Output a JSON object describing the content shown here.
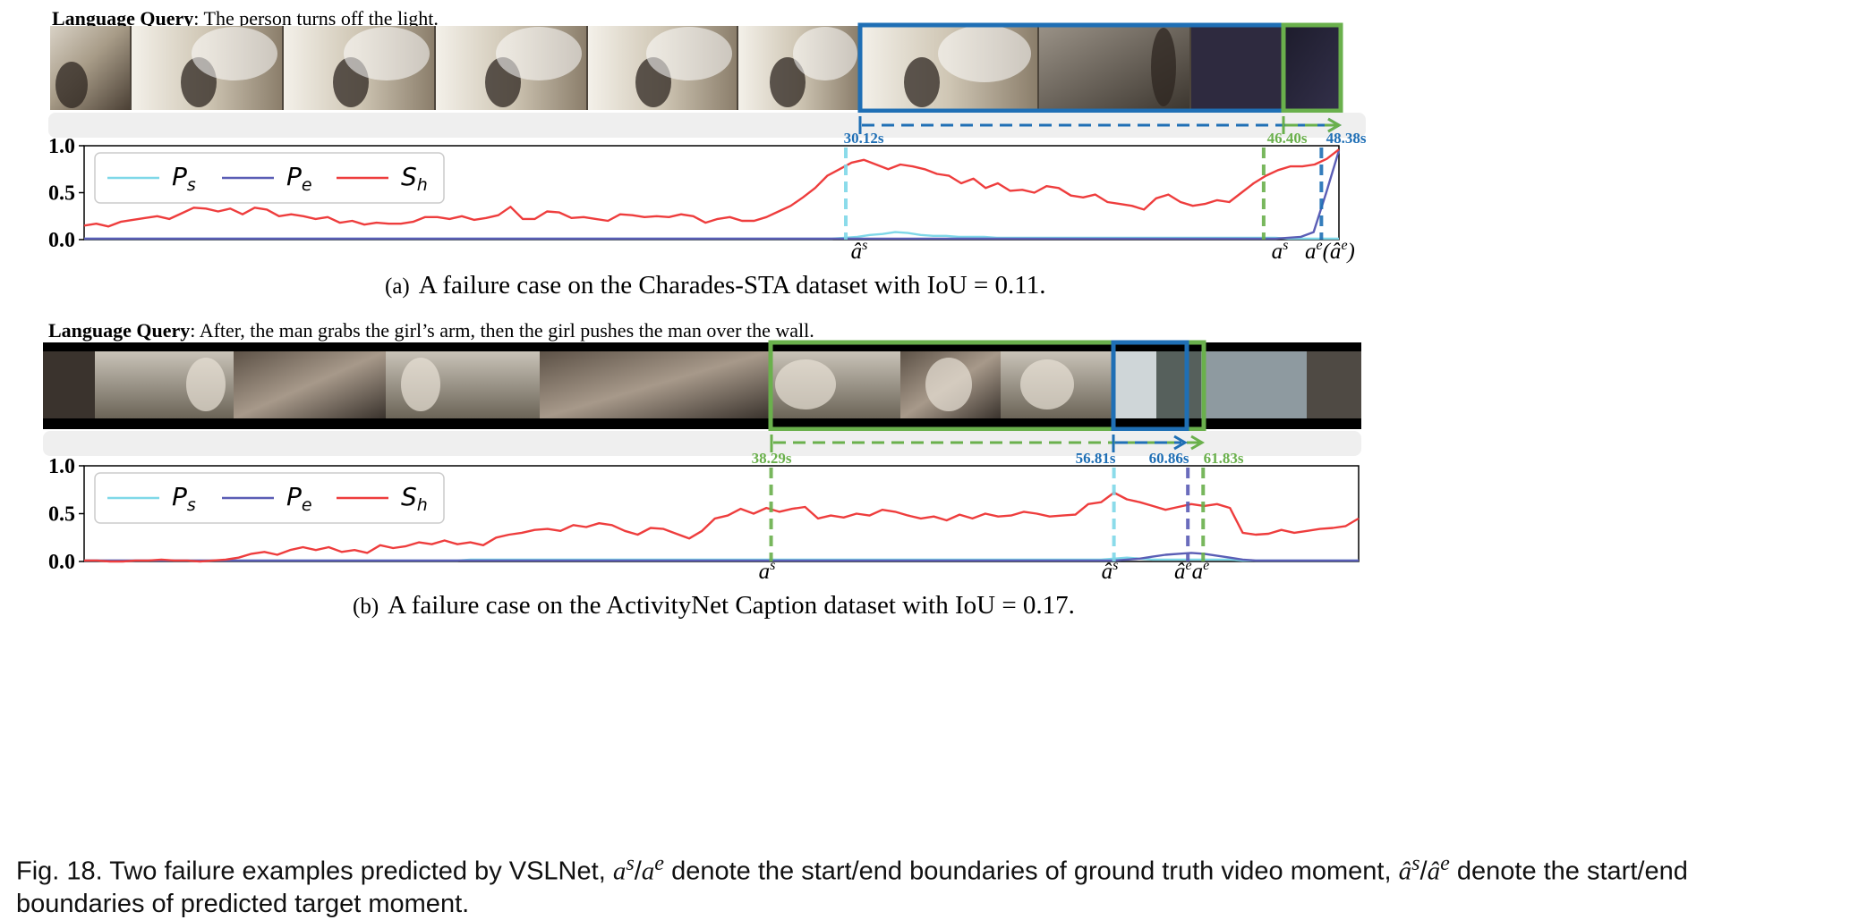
{
  "panel_a": {
    "query_label": "Language Query",
    "query_text": ": The person turns off the light.",
    "subcaption_prefix": "(a)",
    "subcaption_text": "A failure case on the Charades-STA dataset with IoU = 0.11.",
    "times": [
      "30.12s",
      "46.40s",
      "48.38s"
    ],
    "markers": [
      "â",
      "s",
      "a",
      "s",
      "a",
      "e",
      "(â",
      "e",
      ")"
    ]
  },
  "panel_b": {
    "query_label": "Language Query",
    "query_text": ": After, the man grabs the girl’s arm, then the girl pushes the man over the wall.",
    "subcaption_prefix": "(b)",
    "subcaption_text": "A failure case on the ActivityNet Caption dataset with IoU = 0.17.",
    "times": [
      "38.29s",
      "56.81s",
      "60.86s",
      "61.83s"
    ],
    "markers": [
      "a",
      "s",
      "â",
      "s",
      "â",
      "e",
      "a",
      "e"
    ]
  },
  "caption": {
    "part1": "Fig. 18. Two failure examples predicted by VSLNet, ",
    "part2": " denote the start/end boundaries of ground truth video moment, ",
    "part3": " denote the start/end",
    "part4": "boundaries of predicted target moment.",
    "gt_symbol": "a",
    "gt_sup_s": "s",
    "gt_sup_e": "e",
    "pred_symbol": "â",
    "slash": "/"
  },
  "colors": {
    "gt": "#6ab04c",
    "pred": "#1f6fb5",
    "Ps": "#7fd8e8",
    "Pe": "#5a5db5",
    "Sh": "#ee3d3d"
  },
  "chart_data": [
    {
      "type": "line",
      "title": "",
      "xlabel": "",
      "ylabel": "",
      "ylim": [
        0,
        1.0
      ],
      "yticks": [
        "0.0",
        "0.5",
        "1.0"
      ],
      "legend": [
        "P_s",
        "P_e",
        "S_h"
      ],
      "legend_position": "top-left",
      "series": [
        {
          "name": "P_s",
          "values": [
            0.01,
            0.01,
            0.01,
            0.01,
            0.01,
            0.01,
            0.01,
            0.01,
            0.01,
            0.01,
            0.01,
            0.01,
            0.01,
            0.01,
            0.01,
            0.01,
            0.01,
            0.01,
            0.01,
            0.01,
            0.01,
            0.01,
            0.01,
            0.01,
            0.01,
            0.01,
            0.01,
            0.01,
            0.01,
            0.01,
            0.01,
            0.01,
            0.01,
            0.01,
            0.01,
            0.01,
            0.01,
            0.01,
            0.01,
            0.01,
            0.01,
            0.01,
            0.01,
            0.01,
            0.01,
            0.01,
            0.01,
            0.01,
            0.01,
            0.01,
            0.01,
            0.01,
            0.01,
            0.01,
            0.01,
            0.01,
            0.01,
            0.01,
            0.01,
            0.01,
            0.02,
            0.03,
            0.05,
            0.06,
            0.08,
            0.07,
            0.05,
            0.04,
            0.04,
            0.03,
            0.03,
            0.03,
            0.02,
            0.02,
            0.02,
            0.02,
            0.02,
            0.02,
            0.02,
            0.02,
            0.02,
            0.02,
            0.02,
            0.02,
            0.02,
            0.02,
            0.02,
            0.02,
            0.02,
            0.02,
            0.02,
            0.02,
            0.02,
            0.02,
            0.02,
            0.01,
            0.01,
            0.01,
            0.01,
            0.01
          ]
        },
        {
          "name": "P_e",
          "values": [
            0.01,
            0.01,
            0.01,
            0.01,
            0.01,
            0.01,
            0.01,
            0.01,
            0.01,
            0.01,
            0.01,
            0.01,
            0.01,
            0.01,
            0.01,
            0.01,
            0.01,
            0.01,
            0.01,
            0.01,
            0.01,
            0.01,
            0.01,
            0.01,
            0.01,
            0.01,
            0.01,
            0.01,
            0.01,
            0.01,
            0.01,
            0.01,
            0.01,
            0.01,
            0.01,
            0.01,
            0.01,
            0.01,
            0.01,
            0.01,
            0.01,
            0.01,
            0.01,
            0.01,
            0.01,
            0.01,
            0.01,
            0.01,
            0.01,
            0.01,
            0.01,
            0.01,
            0.01,
            0.01,
            0.01,
            0.01,
            0.01,
            0.01,
            0.01,
            0.01,
            0.01,
            0.01,
            0.01,
            0.01,
            0.01,
            0.01,
            0.01,
            0.01,
            0.01,
            0.01,
            0.01,
            0.01,
            0.01,
            0.01,
            0.01,
            0.01,
            0.01,
            0.01,
            0.01,
            0.01,
            0.01,
            0.01,
            0.01,
            0.01,
            0.01,
            0.01,
            0.01,
            0.01,
            0.01,
            0.01,
            0.01,
            0.01,
            0.01,
            0.01,
            0.01,
            0.02,
            0.03,
            0.08,
            0.5,
            0.95
          ]
        },
        {
          "name": "S_h",
          "values": [
            0.15,
            0.17,
            0.14,
            0.19,
            0.21,
            0.23,
            0.25,
            0.22,
            0.28,
            0.34,
            0.33,
            0.3,
            0.33,
            0.27,
            0.34,
            0.32,
            0.25,
            0.27,
            0.25,
            0.22,
            0.24,
            0.18,
            0.2,
            0.16,
            0.18,
            0.17,
            0.17,
            0.19,
            0.24,
            0.24,
            0.22,
            0.25,
            0.21,
            0.23,
            0.26,
            0.35,
            0.22,
            0.22,
            0.3,
            0.29,
            0.23,
            0.24,
            0.22,
            0.2,
            0.27,
            0.26,
            0.24,
            0.25,
            0.24,
            0.27,
            0.25,
            0.18,
            0.22,
            0.24,
            0.2,
            0.2,
            0.24,
            0.3,
            0.36,
            0.45,
            0.55,
            0.68,
            0.75,
            0.82,
            0.85,
            0.8,
            0.75,
            0.8,
            0.78,
            0.75,
            0.7,
            0.68,
            0.6,
            0.65,
            0.55,
            0.6,
            0.52,
            0.53,
            0.5,
            0.57,
            0.55,
            0.47,
            0.45,
            0.48,
            0.4,
            0.38,
            0.36,
            0.32,
            0.44,
            0.48,
            0.4,
            0.36,
            0.38,
            0.42,
            0.4,
            0.5,
            0.6,
            0.68,
            0.74,
            0.78,
            0.78,
            0.8,
            0.86,
            0.96
          ]
        }
      ],
      "x_markers": [
        {
          "label": "â^s",
          "x_frac": 0.607,
          "color": "Ps"
        },
        {
          "label": "a^s",
          "x_frac": 0.94,
          "color": "gt"
        },
        {
          "label": "a^e(â^e)",
          "x_frac": 0.986,
          "color": "pred"
        }
      ]
    },
    {
      "type": "line",
      "title": "",
      "xlabel": "",
      "ylabel": "",
      "ylim": [
        0,
        1.0
      ],
      "yticks": [
        "0.0",
        "0.5",
        "1.0"
      ],
      "legend": [
        "P_s",
        "P_e",
        "S_h"
      ],
      "legend_position": "top-left",
      "series": [
        {
          "name": "P_s",
          "values": [
            0.01,
            0.01,
            0.01,
            0.01,
            0.01,
            0.01,
            0.01,
            0.01,
            0.01,
            0.01,
            0.01,
            0.01,
            0.01,
            0.01,
            0.01,
            0.01,
            0.01,
            0.01,
            0.01,
            0.01,
            0.01,
            0.01,
            0.01,
            0.01,
            0.01,
            0.01,
            0.01,
            0.01,
            0.01,
            0.01,
            0.02,
            0.02,
            0.02,
            0.02,
            0.02,
            0.02,
            0.02,
            0.02,
            0.02,
            0.02,
            0.02,
            0.02,
            0.02,
            0.02,
            0.02,
            0.02,
            0.02,
            0.02,
            0.02,
            0.02,
            0.02,
            0.02,
            0.02,
            0.02,
            0.02,
            0.02,
            0.02,
            0.02,
            0.02,
            0.02,
            0.02,
            0.02,
            0.02,
            0.02,
            0.02,
            0.02,
            0.02,
            0.02,
            0.02,
            0.02,
            0.02,
            0.02,
            0.02,
            0.02,
            0.02,
            0.02,
            0.02,
            0.02,
            0.02,
            0.02,
            0.03,
            0.04,
            0.03,
            0.02,
            0.02,
            0.02,
            0.02,
            0.02,
            0.02,
            0.02,
            0.01,
            0.01,
            0.01,
            0.01,
            0.01,
            0.01,
            0.01,
            0.01,
            0.01,
            0.01
          ]
        },
        {
          "name": "P_e",
          "values": [
            0.01,
            0.01,
            0.01,
            0.01,
            0.01,
            0.01,
            0.01,
            0.01,
            0.01,
            0.01,
            0.01,
            0.01,
            0.01,
            0.01,
            0.01,
            0.01,
            0.01,
            0.01,
            0.01,
            0.01,
            0.01,
            0.01,
            0.01,
            0.01,
            0.01,
            0.01,
            0.01,
            0.01,
            0.01,
            0.01,
            0.01,
            0.01,
            0.01,
            0.01,
            0.01,
            0.01,
            0.01,
            0.01,
            0.01,
            0.01,
            0.01,
            0.01,
            0.01,
            0.01,
            0.01,
            0.01,
            0.01,
            0.01,
            0.01,
            0.01,
            0.01,
            0.01,
            0.01,
            0.01,
            0.01,
            0.01,
            0.01,
            0.01,
            0.01,
            0.01,
            0.01,
            0.01,
            0.01,
            0.01,
            0.01,
            0.01,
            0.01,
            0.01,
            0.01,
            0.01,
            0.01,
            0.01,
            0.01,
            0.01,
            0.01,
            0.01,
            0.01,
            0.01,
            0.01,
            0.01,
            0.01,
            0.02,
            0.03,
            0.05,
            0.07,
            0.08,
            0.09,
            0.08,
            0.06,
            0.04,
            0.02,
            0.01,
            0.01,
            0.01,
            0.01,
            0.01,
            0.01,
            0.01,
            0.01,
            0.01
          ]
        },
        {
          "name": "S_h",
          "values": [
            0.01,
            0.01,
            0.0,
            0.0,
            0.01,
            0.01,
            0.02,
            0.01,
            0.01,
            0.0,
            0.01,
            0.02,
            0.04,
            0.08,
            0.1,
            0.07,
            0.12,
            0.15,
            0.12,
            0.15,
            0.1,
            0.12,
            0.09,
            0.17,
            0.14,
            0.16,
            0.2,
            0.18,
            0.22,
            0.18,
            0.2,
            0.17,
            0.25,
            0.28,
            0.3,
            0.33,
            0.34,
            0.32,
            0.38,
            0.36,
            0.4,
            0.38,
            0.32,
            0.28,
            0.35,
            0.34,
            0.29,
            0.24,
            0.32,
            0.45,
            0.48,
            0.55,
            0.5,
            0.56,
            0.52,
            0.55,
            0.57,
            0.45,
            0.48,
            0.46,
            0.5,
            0.48,
            0.54,
            0.52,
            0.48,
            0.45,
            0.47,
            0.43,
            0.49,
            0.45,
            0.5,
            0.47,
            0.48,
            0.52,
            0.5,
            0.47,
            0.48,
            0.49,
            0.6,
            0.62,
            0.72,
            0.65,
            0.62,
            0.58,
            0.54,
            0.57,
            0.6,
            0.58,
            0.6,
            0.56,
            0.3,
            0.28,
            0.29,
            0.33,
            0.3,
            0.32,
            0.34,
            0.35,
            0.37,
            0.45
          ]
        }
      ],
      "x_markers": [
        {
          "label": "a^s",
          "x_frac": 0.539,
          "color": "gt"
        },
        {
          "label": "â^s",
          "x_frac": 0.808,
          "color": "Ps"
        },
        {
          "label": "â^e",
          "x_frac": 0.866,
          "color": "Pe"
        },
        {
          "label": "a^e",
          "x_frac": 0.878,
          "color": "gt"
        }
      ]
    }
  ]
}
